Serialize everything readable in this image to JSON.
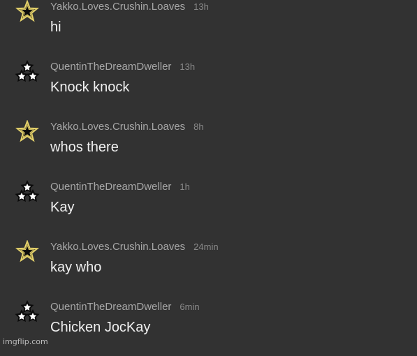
{
  "messages": [
    {
      "username": "Yakko.Loves.Crushin.Loaves",
      "time": "13h",
      "text": "hi",
      "avatar": "gold-star-icon"
    },
    {
      "username": "QuentinTheDreamDweller",
      "time": "13h",
      "text": "Knock knock",
      "avatar": "three-stars-icon"
    },
    {
      "username": "Yakko.Loves.Crushin.Loaves",
      "time": "8h",
      "text": "whos there",
      "avatar": "gold-star-icon"
    },
    {
      "username": "QuentinTheDreamDweller",
      "time": "1h",
      "text": "Kay",
      "avatar": "three-stars-icon"
    },
    {
      "username": "Yakko.Loves.Crushin.Loaves",
      "time": "24min",
      "text": "kay who",
      "avatar": "gold-star-icon"
    },
    {
      "username": "QuentinTheDreamDweller",
      "time": "6min",
      "text": "Chicken JocKay",
      "avatar": "three-stars-icon"
    }
  ],
  "watermark": "imgflip.com",
  "colors": {
    "background": "#323232",
    "username": "#a7a7a7",
    "timestamp": "#8a8a8a",
    "message": "#f0f0f0",
    "gold_star": "#e6d36b"
  }
}
